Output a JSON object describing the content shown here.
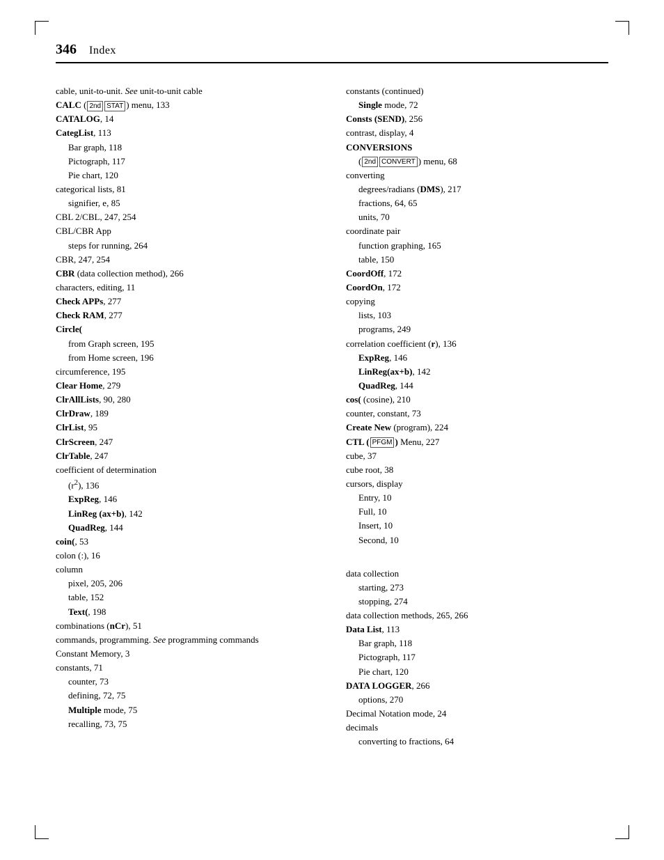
{
  "page": {
    "number": "346",
    "title": "Index"
  },
  "left_column": [
    {
      "type": "entry",
      "text": "cable, unit-to-unit. ",
      "italic_suffix": "See",
      "suffix": " unit-to-unit cable"
    },
    {
      "type": "entry",
      "bold": true,
      "text": "CALC",
      "suffix": " (",
      "key1": "2nd",
      "key2": "STAT",
      "end": ") menu, 133"
    },
    {
      "type": "entry",
      "bold": true,
      "text": "CATALOG",
      "suffix": ", 14"
    },
    {
      "type": "entry",
      "bold": true,
      "text": "CategList",
      "suffix": ", 113"
    },
    {
      "type": "indent1",
      "text": "Bar graph, 118"
    },
    {
      "type": "indent1",
      "text": "Pictograph, 117"
    },
    {
      "type": "indent1",
      "text": "Pie chart, 120"
    },
    {
      "type": "entry",
      "text": "categorical lists, 81"
    },
    {
      "type": "indent1",
      "text": "signifier, e, 85"
    },
    {
      "type": "entry",
      "text": "CBL 2/CBL, 247, 254"
    },
    {
      "type": "entry",
      "text": "CBL/CBR App"
    },
    {
      "type": "indent1",
      "text": "steps for running, 264"
    },
    {
      "type": "entry",
      "text": "CBR, 247, 254"
    },
    {
      "type": "entry",
      "bold_prefix": "CBR",
      "text": " (data collection method), 266"
    },
    {
      "type": "entry",
      "text": "characters, editing, 11"
    },
    {
      "type": "entry",
      "bold": true,
      "text": "Check APPs",
      "suffix": ", 277"
    },
    {
      "type": "entry",
      "bold": true,
      "text": "Check RAM",
      "suffix": ", 277"
    },
    {
      "type": "entry",
      "bold": true,
      "text": "Circle("
    },
    {
      "type": "indent1",
      "text": "from Graph screen, 195"
    },
    {
      "type": "indent1",
      "text": "from Home screen, 196"
    },
    {
      "type": "entry",
      "text": "circumference, 195"
    },
    {
      "type": "entry",
      "bold": true,
      "text": "Clear Home",
      "suffix": ", 279"
    },
    {
      "type": "entry",
      "bold": true,
      "text": "ClrAllLists",
      "suffix": ", 90, 280"
    },
    {
      "type": "entry",
      "bold": true,
      "text": "ClrDraw",
      "suffix": ", 189"
    },
    {
      "type": "entry",
      "bold": true,
      "text": "ClrList",
      "suffix": ", 95"
    },
    {
      "type": "entry",
      "bold": true,
      "text": "ClrScreen",
      "suffix": ", 247"
    },
    {
      "type": "entry",
      "bold": true,
      "text": "ClrTable",
      "suffix": ", 247"
    },
    {
      "type": "entry",
      "text": "coefficient of determination"
    },
    {
      "type": "indent1",
      "text": "(r²), 136"
    },
    {
      "type": "indent1",
      "bold": true,
      "text": "ExpReg",
      "suffix": ", 146"
    },
    {
      "type": "indent1",
      "bold": true,
      "text": "LinReg (ax+b)",
      "suffix": ", 142"
    },
    {
      "type": "indent1",
      "bold": true,
      "text": "QuadReg",
      "suffix": ", 144"
    },
    {
      "type": "entry",
      "bold": true,
      "text": "coin(",
      "suffix": ", 53"
    },
    {
      "type": "entry",
      "text": "colon (:), 16"
    },
    {
      "type": "entry",
      "text": "column"
    },
    {
      "type": "indent1",
      "text": "pixel, 205, 206"
    },
    {
      "type": "indent1",
      "text": "table, 152"
    },
    {
      "type": "indent1",
      "bold": true,
      "text": "Text(",
      "suffix": ", 198"
    },
    {
      "type": "entry",
      "text": "combinations (nCr), 51"
    },
    {
      "type": "entry",
      "text": "commands, programming. ",
      "italic_suffix": "See",
      "suffix": " programming commands"
    },
    {
      "type": "entry",
      "text": "Constant Memory, 3"
    },
    {
      "type": "entry",
      "text": "constants, 71"
    },
    {
      "type": "indent1",
      "text": "counter, 73"
    },
    {
      "type": "indent1",
      "text": "defining, 72, 75"
    },
    {
      "type": "indent1",
      "bold": true,
      "text": "Multiple",
      "suffix": " mode, 75"
    },
    {
      "type": "indent1",
      "text": "recalling, 73, 75"
    }
  ],
  "right_column": [
    {
      "type": "entry",
      "text": "constants (continued)"
    },
    {
      "type": "indent1",
      "bold": true,
      "text": "Single",
      "suffix": " mode, 72"
    },
    {
      "type": "entry",
      "bold": true,
      "text": "Consts (SEND)",
      "suffix": ", 256"
    },
    {
      "type": "entry",
      "text": "contrast, display, 4"
    },
    {
      "type": "entry",
      "bold": true,
      "text": "CONVERSIONS"
    },
    {
      "type": "indent1",
      "text": "(",
      "key1": "2nd",
      "key2": "CONVERT",
      "end": ") menu, 68"
    },
    {
      "type": "entry",
      "text": "converting"
    },
    {
      "type": "indent1",
      "text": "degrees/radians (DMS), 217"
    },
    {
      "type": "indent1",
      "text": "fractions, 64, 65"
    },
    {
      "type": "indent1",
      "text": "units, 70"
    },
    {
      "type": "entry",
      "text": "coordinate pair"
    },
    {
      "type": "indent1",
      "text": "function graphing, 165"
    },
    {
      "type": "indent1",
      "text": "table, 150"
    },
    {
      "type": "entry",
      "bold": true,
      "text": "CoordOff",
      "suffix": ", 172"
    },
    {
      "type": "entry",
      "bold": true,
      "text": "CoordOn",
      "suffix": ", 172"
    },
    {
      "type": "entry",
      "text": "copying"
    },
    {
      "type": "indent1",
      "text": "lists, 103"
    },
    {
      "type": "indent1",
      "text": "programs, 249"
    },
    {
      "type": "entry",
      "text": "correlation coefficient (r), 136"
    },
    {
      "type": "indent1",
      "bold": true,
      "text": "ExpReg",
      "suffix": ", 146"
    },
    {
      "type": "indent1",
      "bold": true,
      "text": "LinReg(ax+b)",
      "suffix": ", 142"
    },
    {
      "type": "indent1",
      "bold": true,
      "text": "QuadReg",
      "suffix": ", 144"
    },
    {
      "type": "entry",
      "bold": true,
      "text": "cos(",
      "suffix": " (cosine), 210"
    },
    {
      "type": "entry",
      "text": "counter, constant, 73"
    },
    {
      "type": "entry",
      "bold": true,
      "text": "Create New",
      "suffix": " (program), 224"
    },
    {
      "type": "entry",
      "bold": true,
      "text": "CTL (",
      "key1": "PFGM",
      "end": ") Menu, 227"
    },
    {
      "type": "entry",
      "text": "cube, 37"
    },
    {
      "type": "entry",
      "text": "cube root, 38"
    },
    {
      "type": "entry",
      "text": "cursors, display"
    },
    {
      "type": "indent1",
      "text": "Entry, 10"
    },
    {
      "type": "indent1",
      "text": "Full, 10"
    },
    {
      "type": "indent1",
      "text": "Insert, 10"
    },
    {
      "type": "indent1",
      "text": "Second, 10"
    },
    {
      "type": "spacer"
    },
    {
      "type": "spacer"
    },
    {
      "type": "entry",
      "text": "data collection"
    },
    {
      "type": "indent1",
      "text": "starting, 273"
    },
    {
      "type": "indent1",
      "text": "stopping, 274"
    },
    {
      "type": "entry",
      "text": "data collection methods, 265, 266"
    },
    {
      "type": "entry",
      "bold": true,
      "text": "Data List",
      "suffix": ", 113"
    },
    {
      "type": "indent1",
      "text": "Bar graph, 118"
    },
    {
      "type": "indent1",
      "text": "Pictograph, 117"
    },
    {
      "type": "indent1",
      "text": "Pie chart, 120"
    },
    {
      "type": "entry",
      "bold": true,
      "text": "DATA LOGGER",
      "suffix": ", 266"
    },
    {
      "type": "indent1",
      "text": "options, 270"
    },
    {
      "type": "entry",
      "text": "Decimal Notation mode, 24"
    },
    {
      "type": "entry",
      "text": "decimals"
    },
    {
      "type": "indent1",
      "text": "converting to fractions, 64"
    }
  ]
}
